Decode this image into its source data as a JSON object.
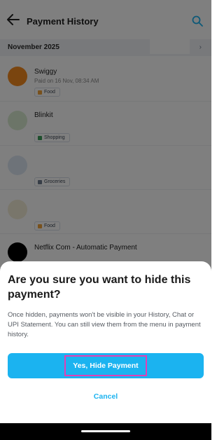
{
  "header": {
    "title": "Payment History",
    "back_icon": "arrow-left-icon",
    "search_icon": "search-icon"
  },
  "month_section": {
    "label": "November 2025",
    "chevron": "›"
  },
  "transactions": [
    {
      "merchant": "Swiggy",
      "meta": "Paid on 16 Nov, 08:34 AM",
      "tag": "Food",
      "logo_color": "#f58a1f",
      "tag_color": "#f0a33a"
    },
    {
      "merchant": "Blinkit",
      "meta": "",
      "tag": "Shopping",
      "logo_color": "#d9ead0",
      "tag_color": "#3c9e5a"
    },
    {
      "merchant": "",
      "meta": "",
      "tag": "Groceries",
      "logo_color": "#dde7f3",
      "tag_color": "#6f7d8f"
    },
    {
      "merchant": "",
      "meta": "",
      "tag": "Food",
      "logo_color": "#f3ecd6",
      "tag_color": "#f0a33a"
    },
    {
      "merchant": "Netflix Com - Automatic Payment",
      "meta": "",
      "tag": "",
      "logo_color": "#000000",
      "tag_color": "#e50914"
    }
  ],
  "dialog": {
    "title": "Are you sure you want to hide this payment?",
    "body": "Once hidden, payments won't be visible in your History, Chat or UPI Statement. You can still view them from the menu in payment history.",
    "confirm_label": "Yes, Hide Payment",
    "cancel_label": "Cancel"
  },
  "colors": {
    "accent": "#1bb3f0",
    "highlight": "#e33fb5"
  }
}
